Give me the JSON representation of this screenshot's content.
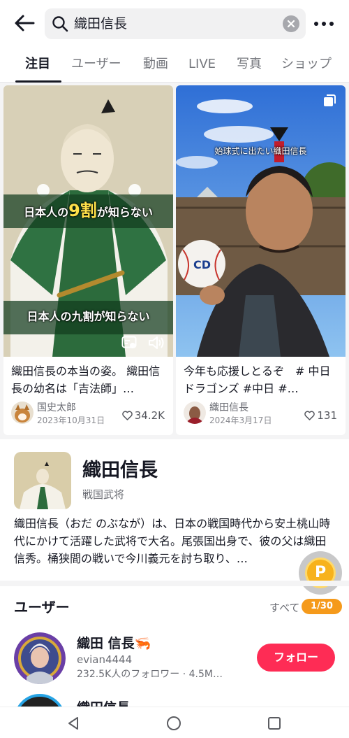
{
  "search": {
    "query": "織田信長"
  },
  "tabs": [
    "注目",
    "ユーザー",
    "動画",
    "LIVE",
    "写真",
    "ショップ"
  ],
  "active_tab": "注目",
  "results": [
    {
      "overlay_top_pre": "日本人の",
      "overlay_top_big": "9割",
      "overlay_top_post": "が知らない",
      "overlay_bottom": "日本人の九割が知らない",
      "title": "織田信長の本当の姿。 織田信長の幼名は「吉法師」…",
      "author": "国史太郎",
      "date": "2023年10月31日",
      "likes": "34.2K"
    },
    {
      "overlay_top": "始球式に出たい織田信長",
      "title": "今年も応援しとるぞ　# 中日ドラゴンズ #中日 #…",
      "author": "織田信長",
      "date": "2024年3月17日",
      "likes": "131"
    }
  ],
  "knowledge": {
    "title": "織田信長",
    "subtitle": "戦国武将",
    "description": "織田信長（おだ のぶなが）は、日本の戦国時代から安土桃山時代にかけて活躍した武将で大名。尾張国出身で、彼の父は織田信秀。桶狭間の戦いで今川義元を討ち取り、…"
  },
  "points_badge": {
    "label": "P"
  },
  "users_section": {
    "title": "ユーザー",
    "see_all": "すべて",
    "page_indicator": "1/30",
    "users": [
      {
        "name": "織田 信長🦐",
        "handle": "evian4444",
        "stats": "232.5K人のフォロワー · 4.5M…",
        "follow_label": "フォロー"
      },
      {
        "name": "織田信長"
      }
    ]
  },
  "colors": {
    "accent": "#fe2c55",
    "points": "#f7b21c",
    "pill": "#f59a1b"
  }
}
